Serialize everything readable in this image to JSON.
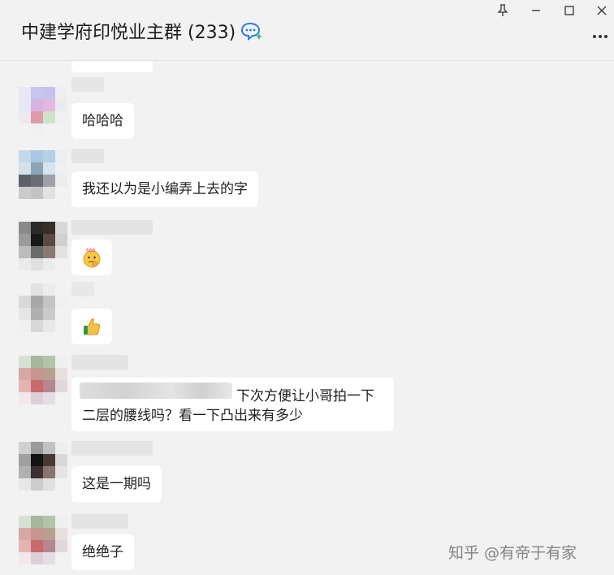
{
  "header": {
    "title": "中建学府印悦业主群 (233)",
    "title_icon": "chat-bubble-sparkle-icon",
    "pin_icon": "pin-icon",
    "minimize_icon": "minimize-icon",
    "maximize_icon": "maximize-icon",
    "close_icon": "close-icon",
    "more_icon": "more-dots-icon"
  },
  "messages": [
    {
      "type": "text",
      "text": "哈哈哈"
    },
    {
      "type": "text",
      "text": "我还以为是小编弄上去的字"
    },
    {
      "type": "emoji",
      "emoji": "thinking-666-emoji"
    },
    {
      "type": "emoji",
      "emoji": "thumbs-up-emoji"
    },
    {
      "type": "text",
      "line1": "下次方便让小哥拍一下",
      "line2": "二层的腰线吗？看一下凸出来有多少"
    },
    {
      "type": "text",
      "text": "这是一期吗"
    },
    {
      "type": "text",
      "text": "绝绝子"
    }
  ],
  "watermark": "知乎 @有帝于有家",
  "colors": {
    "background": "#f2f2f2",
    "bubble": "#ffffff",
    "text": "#1f1f1f"
  }
}
